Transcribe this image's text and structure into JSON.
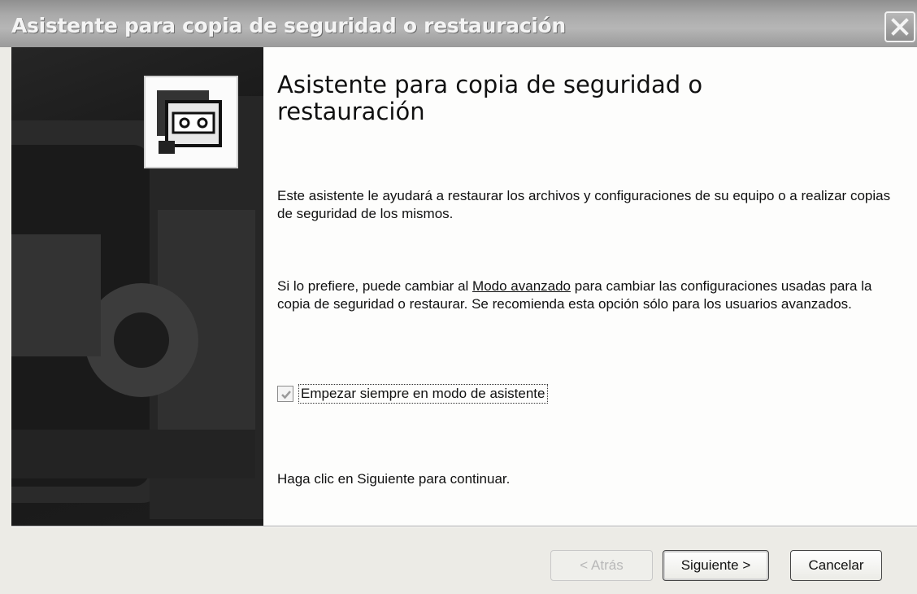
{
  "window": {
    "title": "Asistente para copia de seguridad o restauración",
    "close_icon": "close-icon"
  },
  "banner": {
    "icon": "backup-tape-icon"
  },
  "content": {
    "heading": "Asistente para copia de seguridad o restauración",
    "paragraph1": "Este asistente le ayudará  a restaurar los archivos y configuraciones de su equipo o a realizar copias de seguridad de los mismos.",
    "paragraph2_before": "Si lo prefiere, puede cambiar al ",
    "paragraph2_link": "Modo avanzado",
    "paragraph2_after": " para cambiar las configuraciones usadas para la copia de seguridad o restaurar. Se recomienda esta opción sólo para los usuarios avanzados.",
    "checkbox_label": "Empezar siempre en modo de asistente",
    "checkbox_checked": true,
    "footer_text": "Haga clic en Siguiente para continuar."
  },
  "buttons": {
    "back": "< Atrás",
    "next": "Siguiente >",
    "cancel": "Cancelar"
  }
}
